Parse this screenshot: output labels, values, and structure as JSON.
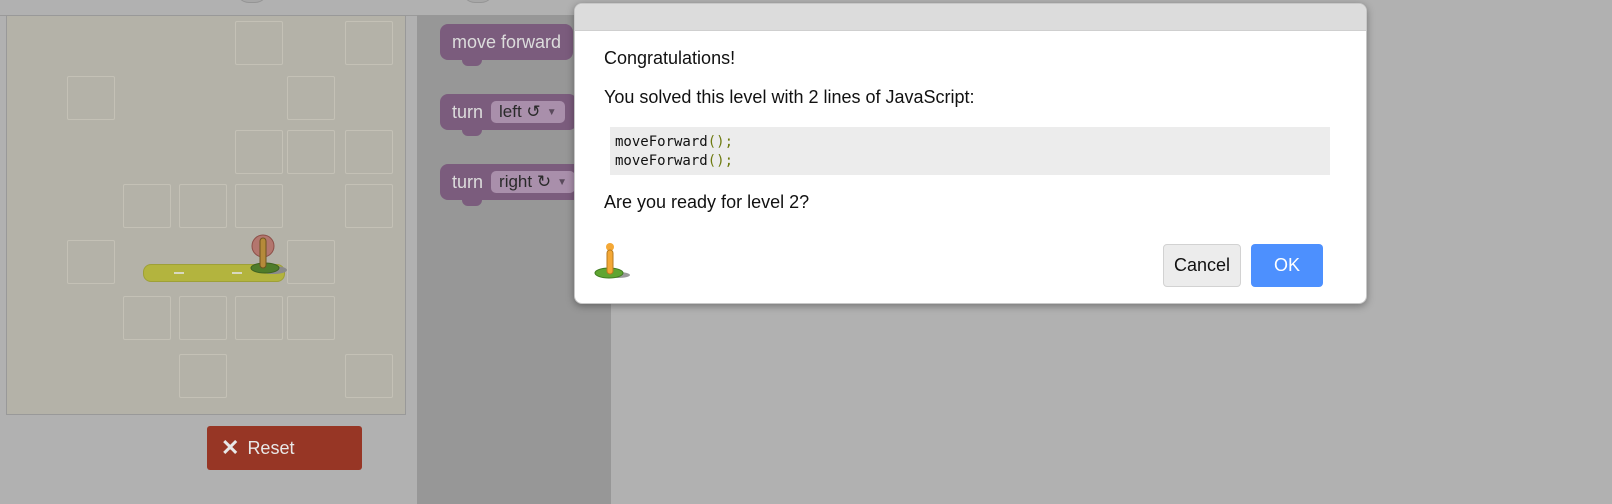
{
  "maze": {
    "reset_label": "Reset"
  },
  "toolbox": {
    "blocks": [
      {
        "label": "move forward"
      },
      {
        "label": "turn",
        "dropdown": "left ↺"
      },
      {
        "label": "turn",
        "dropdown": "right ↻"
      }
    ]
  },
  "dialog": {
    "heading": "Congratulations!",
    "summary": "You solved this level with 2 lines of JavaScript:",
    "code_lines": [
      {
        "fn": "moveForward",
        "parens": "();"
      },
      {
        "fn": "moveForward",
        "parens": "();"
      }
    ],
    "question": "Are you ready for level 2?",
    "cancel_label": "Cancel",
    "ok_label": "OK",
    "icon": "pegman-icon"
  },
  "colors": {
    "block_purple": "#7b5c7d",
    "reset_red": "#973625",
    "ok_blue": "#4d90fe",
    "path_yellow": "#b3b43e"
  }
}
